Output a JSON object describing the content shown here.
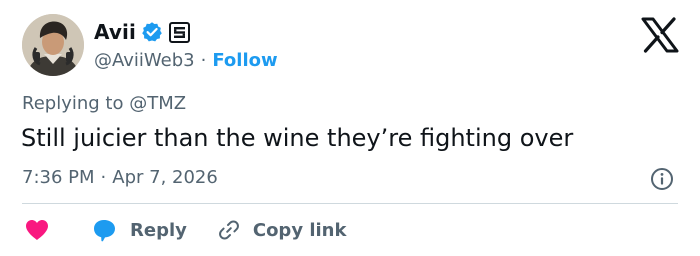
{
  "post": {
    "author": {
      "display_name": "Avii",
      "handle": "@AviiWeb3",
      "verified": true,
      "affiliation_badge": "id-card-icon"
    },
    "separator": "·",
    "follow_label": "Follow",
    "replying_prefix": "Replying to ",
    "replying_to": "@TMZ",
    "text": "Still juicier than the wine they’re fighting over",
    "time": "7:36 PM",
    "date": "Apr 7, 2026"
  },
  "actions": {
    "like_icon": "heart-icon",
    "reply_label": "Reply",
    "copy_link_label": "Copy link"
  },
  "colors": {
    "accent": "#1d9bf0",
    "like": "#f91880",
    "text_primary": "#0f1419",
    "text_secondary": "#536471",
    "divider": "#cfd9de"
  }
}
